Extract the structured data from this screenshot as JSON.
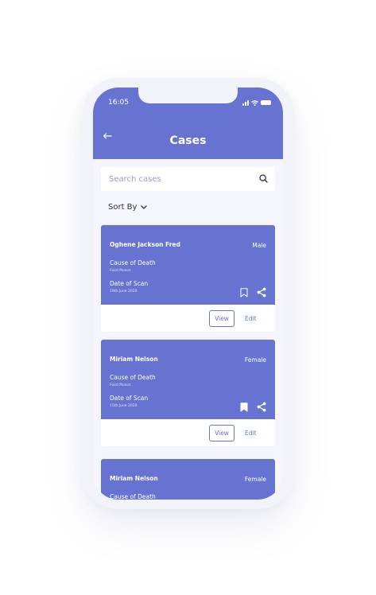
{
  "status_bar": {
    "time": "16:05"
  },
  "header": {
    "title": "Cases"
  },
  "search": {
    "placeholder": "Search cases"
  },
  "sort": {
    "label": "Sort By"
  },
  "cases": [
    {
      "name": "Oghene Jackson Fred",
      "gender": "Male",
      "cause_label": "Cause of Death",
      "cause_value": "Food Poison",
      "scan_label": "Date of Scan",
      "scan_value": "19th June 2020",
      "bookmarked": false,
      "view_label": "View",
      "edit_label": "Edit"
    },
    {
      "name": "Miriam Nelson",
      "gender": "Female",
      "cause_label": "Cause of Death",
      "cause_value": "Food Poison",
      "scan_label": "Date of Scan",
      "scan_value": "15th June 2020",
      "bookmarked": true,
      "view_label": "View",
      "edit_label": "Edit"
    },
    {
      "name": "Miriam Nelson",
      "gender": "Female",
      "cause_label": "Cause of Death"
    }
  ],
  "colors": {
    "primary": "#6673d0",
    "background": "#f5f6fb",
    "text_dark": "#2e3247"
  }
}
